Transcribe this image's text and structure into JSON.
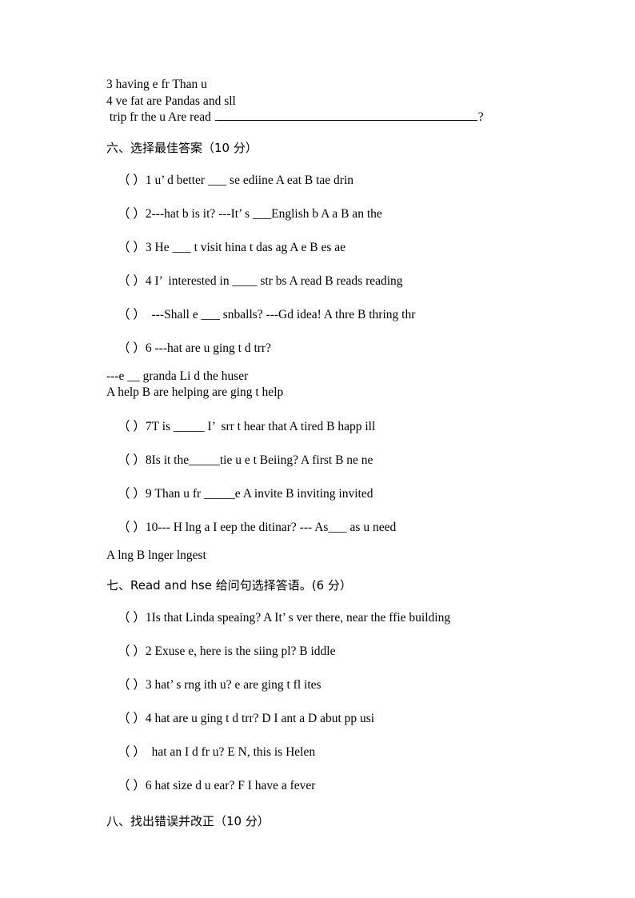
{
  "document": {
    "type": "english-exam-worksheet",
    "page_background": "#ffffff",
    "text_color": "#000000"
  },
  "top_block": {
    "line1": "3 having e fr Than u",
    "line2": "4 ve fat are Pandas and sll",
    "line3_before": " trip fr the u Are read ",
    "line3_after": "?"
  },
  "section_six": {
    "heading": "六、选择最佳答案（10 分）",
    "items": [
      "（ ）1 u’ d better ___ se ediine A eat B tae drin",
      "（ ）2---hat b is it? ---It’ s ___English b A a B an the",
      "（ ）3 He ___ t visit hina t das ag A e B es ae",
      "（ ）4 I’  interested in ____ str bs A read B reads reading",
      "（ ）  ---Shall e ___ snballs? ---Gd idea! A thre B thring thr",
      "（ ）6 ---hat are u ging t d trr?"
    ],
    "item6_continuation_1": "---e __ granda Li d the huser",
    "item6_continuation_2": "A help B are helping are ging t help",
    "items_after": [
      "（ ）7T is _____ I’  srr t hear that A tired B happ ill",
      "（ ）8Is it the_____tie u e t Beiing? A first B ne ne",
      "（ ）9 Than u fr _____e A invite B inviting invited",
      "（ ）10--- H lng a I eep the ditinar? --- As___ as u need"
    ],
    "item10_continuation": "A lng B lnger lngest"
  },
  "section_seven": {
    "heading": "七、Read and hse 给问句选择答语。(6 分）",
    "items": [
      "（ ）1Is that Linda speaing? A It’ s ver there, near the ffie building",
      "（ ）2 Exuse e, here is the siing pl? B iddle",
      "（ ）3 hat’ s rng ith u? e are ging t fl ites",
      "（ ）4 hat are u ging t d trr? D I ant a D abut pp usi",
      "（ ）  hat an I d fr u? E N, this is Helen",
      "（ ）6 hat size d u ear? F I have a fever"
    ]
  },
  "section_eight": {
    "heading": "八、找出错误并改正（10 分）"
  }
}
